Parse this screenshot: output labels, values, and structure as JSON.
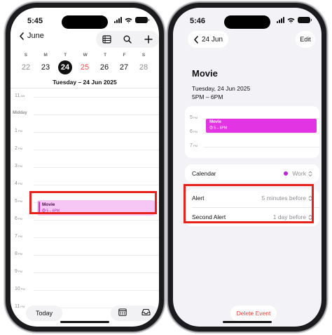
{
  "left_phone": {
    "status_time": "5:45",
    "back_label": "June",
    "weekdays": [
      "S",
      "M",
      "T",
      "W",
      "T",
      "F",
      "S"
    ],
    "dates": [
      {
        "label": "22",
        "state": "muted"
      },
      {
        "label": "23",
        "state": "normal"
      },
      {
        "label": "24",
        "state": "selected"
      },
      {
        "label": "25",
        "state": "today"
      },
      {
        "label": "26",
        "state": "normal"
      },
      {
        "label": "27",
        "state": "normal"
      },
      {
        "label": "28",
        "state": "muted"
      }
    ],
    "day_title": "Tuesday – 24 Jun 2025",
    "hours": [
      {
        "num": "11",
        "ampm": "AM"
      },
      {
        "num": "Midday",
        "ampm": ""
      },
      {
        "num": "1",
        "ampm": "PM"
      },
      {
        "num": "2",
        "ampm": "PM"
      },
      {
        "num": "3",
        "ampm": "PM"
      },
      {
        "num": "4",
        "ampm": "PM"
      },
      {
        "num": "5",
        "ampm": "PM"
      },
      {
        "num": "6",
        "ampm": "PM"
      },
      {
        "num": "7",
        "ampm": "PM"
      },
      {
        "num": "8",
        "ampm": "PM"
      },
      {
        "num": "9",
        "ampm": "PM"
      },
      {
        "num": "10",
        "ampm": "PM"
      },
      {
        "num": "11",
        "ampm": "PM"
      }
    ],
    "event": {
      "title": "Movie",
      "time": "5 – 6PM"
    },
    "today_label": "Today"
  },
  "right_phone": {
    "status_time": "5:46",
    "back_label": "24 Jun",
    "edit_label": "Edit",
    "event_title": "Movie",
    "event_date": "Tuesday, 24 Jun 2025",
    "event_time": "5PM – 6PM",
    "mini_hours": [
      {
        "num": "5",
        "ampm": "PM"
      },
      {
        "num": "6",
        "ampm": "PM"
      },
      {
        "num": "7",
        "ampm": "PM"
      }
    ],
    "mini_event": {
      "title": "Movie",
      "time": "5 – 6PM"
    },
    "calendar_label": "Calendar",
    "calendar_value": "Work",
    "alert_label": "Alert",
    "alert_value": "5 minutes before",
    "second_alert_label": "Second Alert",
    "second_alert_value": "1 day before",
    "delete_label": "Delete Event"
  },
  "colors": {
    "accent_red": "#e8504a",
    "event_magenta": "#e334e3",
    "highlight_red": "#e8211b",
    "delete_red": "#ef3a32"
  }
}
